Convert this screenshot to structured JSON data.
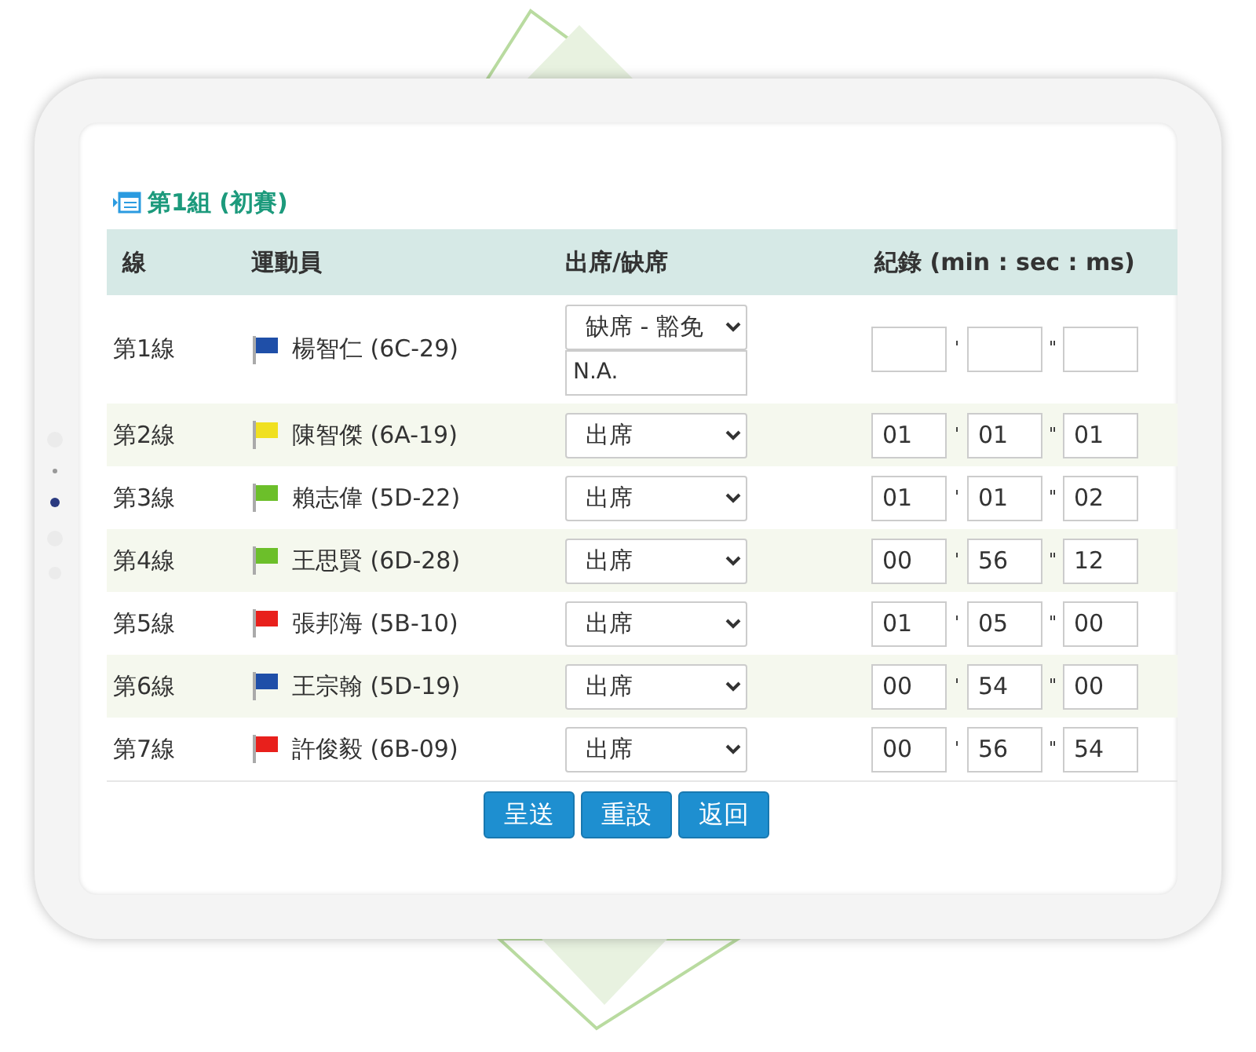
{
  "heading": "第1組 (初賽)",
  "columns": [
    "線",
    "運動員",
    "出席/缺席",
    "紀錄 (min : sec : ms)"
  ],
  "rows": [
    {
      "lane": "第1線",
      "color": "#1f4fa8",
      "athlete": "楊智仁 (6C-29)",
      "attendance": "缺席 - 豁免",
      "note": "N.A.",
      "record": {
        "min_mark": "'",
        "sec_mark": "\""
      }
    },
    {
      "lane": "第2線",
      "color": "#f0e020",
      "athlete": "陳智傑 (6A-19)",
      "attendance": "出席",
      "record": {
        "min": "01",
        "min_mark": "'",
        "sec": "01",
        "sec_mark": "\"",
        "ms": "01"
      }
    },
    {
      "lane": "第3線",
      "color": "#6cbf2a",
      "athlete": "賴志偉 (5D-22)",
      "attendance": "出席",
      "record": {
        "min": "01",
        "min_mark": "'",
        "sec": "01",
        "sec_mark": "\"",
        "ms": "02"
      }
    },
    {
      "lane": "第4線",
      "color": "#6cbf2a",
      "athlete": "王思賢 (6D-28)",
      "attendance": "出席",
      "record": {
        "min": "00",
        "min_mark": "'",
        "sec": "56",
        "sec_mark": "\"",
        "ms": "12"
      }
    },
    {
      "lane": "第5線",
      "color": "#e8201c",
      "athlete": "張邦海 (5B-10)",
      "attendance": "出席",
      "record": {
        "min": "01",
        "min_mark": "'",
        "sec": "05",
        "sec_mark": "\"",
        "ms": "00"
      }
    },
    {
      "lane": "第6線",
      "color": "#1f4fa8",
      "athlete": "王宗翰 (5D-19)",
      "attendance": "出席",
      "record": {
        "min": "00",
        "min_mark": "'",
        "sec": "54",
        "sec_mark": "\"",
        "ms": "00"
      }
    },
    {
      "lane": "第7線",
      "color": "#e8201c",
      "athlete": "許俊毅 (6B-09)",
      "attendance": "出席",
      "record": {
        "min": "00",
        "min_mark": "'",
        "sec": "56",
        "sec_mark": "\"",
        "ms": "54"
      }
    }
  ],
  "buttons": [
    "呈送",
    "重設",
    "返回"
  ]
}
